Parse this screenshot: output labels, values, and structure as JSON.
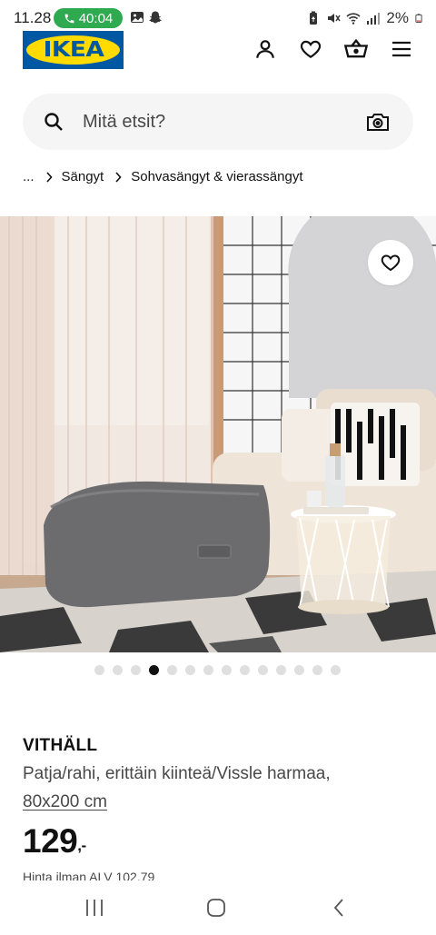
{
  "status_bar": {
    "time": "11.28",
    "call_timer": "40:04",
    "battery": "2%"
  },
  "header": {
    "logo_text": "IKEA",
    "icons": [
      "account-icon",
      "heart-icon",
      "basket-icon",
      "menu-icon"
    ]
  },
  "search": {
    "placeholder": "Mitä etsit?"
  },
  "breadcrumb": {
    "items": [
      "...",
      "Sängyt",
      "Sohvasängyt & vierassängyt"
    ]
  },
  "gallery": {
    "dot_count": 14,
    "active_index": 3
  },
  "product": {
    "name": "VITHÄLL",
    "description": "Patja/rahi, erittäin kiinteä/Vissle harmaa,",
    "size": "80x200 cm",
    "price_main": "129",
    "price_suffix": ",-",
    "vat_text": "Hinta ilman ALV 102,79"
  },
  "colors": {
    "ikea_blue": "#0058a3",
    "ikea_yellow": "#ffdb00",
    "call_green": "#2faa51"
  }
}
